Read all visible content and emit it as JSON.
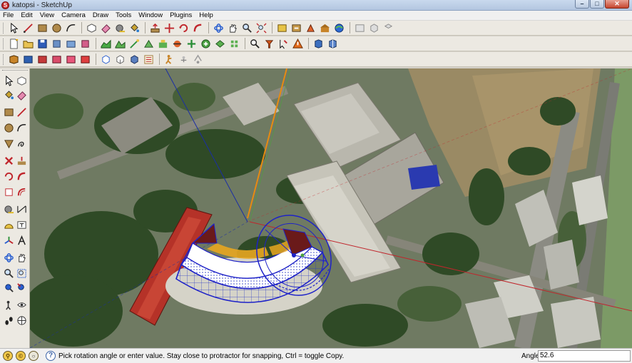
{
  "window": {
    "title": "katopsi - SketchUp",
    "controls": [
      "minimize",
      "maximize",
      "close"
    ]
  },
  "menu": [
    "File",
    "Edit",
    "View",
    "Camera",
    "Draw",
    "Tools",
    "Window",
    "Plugins",
    "Help"
  ],
  "toolbars": {
    "row1": [
      "select-icon",
      "line-icon",
      "rectangle-icon",
      "circle-icon",
      "arc-icon",
      "eraser-icon",
      "paint-bucket-icon",
      "push-pull-icon",
      "move-icon",
      "rotate-icon",
      "follow-me-icon",
      "offset-icon",
      "orbit-icon",
      "pan-icon",
      "zoom-icon",
      "zoom-extents-icon",
      "get-models-icon",
      "share-model-icon",
      "components-icon",
      "warehouse-icon",
      "add-location-icon",
      "photo-texture-icon",
      "iso-view-icon",
      "top-view-icon"
    ],
    "row2": [
      "new-file-icon",
      "open-file-icon",
      "save-icon",
      "cut-icon",
      "copy-icon",
      "paste-icon",
      "make-component-icon",
      "sandbox-icon",
      "terrain-icon",
      "add-detail-icon",
      "flip-edge-icon",
      "stamp-icon",
      "drape-icon",
      "smoove-icon",
      "section-plane-icon",
      "tape-measure-icon",
      "dimension-icon",
      "text-icon",
      "warning-icon",
      "xray-icon",
      "back-edges-icon"
    ],
    "row3": [
      "views-icon",
      "style-wireframe-icon",
      "style-hidden-icon",
      "style-shaded-icon",
      "style-textured-icon",
      "style-monochrome-icon",
      "front-view-icon",
      "right-view-icon",
      "back-view-icon",
      "layers-icon",
      "walk-icon",
      "look-around-icon",
      "position-camera-icon"
    ]
  },
  "left_toolbar": [
    "select-icon",
    "make-component-icon",
    "paint-bucket-icon",
    "eraser-icon",
    "rectangle-icon",
    "line-icon",
    "circle-icon",
    "arc-icon",
    "polygon-icon",
    "freehand-icon",
    "move-icon",
    "push-pull-icon",
    "rotate-icon",
    "follow-me-icon",
    "scale-icon",
    "offset-icon",
    "tape-measure-icon",
    "dimension-icon",
    "protractor-icon",
    "text-icon",
    "axes-icon",
    "3d-text-icon",
    "orbit-icon",
    "pan-icon",
    "zoom-icon",
    "zoom-window-icon",
    "zoom-extents-icon",
    "previous-view-icon",
    "position-camera-icon",
    "look-around-icon",
    "walk-icon",
    "section-plane-icon"
  ],
  "status": {
    "hint": "Pick rotation angle or enter value.  Stay close to protractor for snapping, Ctrl = toggle Copy.",
    "measure_label": "Angle",
    "measure_value": "52.6"
  },
  "colors": {
    "axis_red": "#c0262c",
    "axis_blue": "#1b2ea5",
    "axis_orange": "#e88a12",
    "protractor_blue": "#1e22c8",
    "roof_red": "#b53228"
  }
}
